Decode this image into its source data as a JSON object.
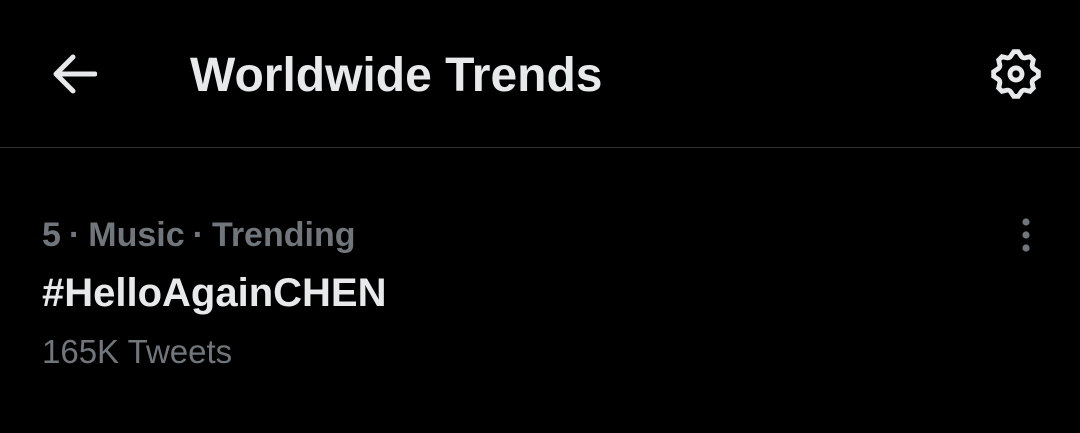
{
  "header": {
    "title": "Worldwide Trends",
    "back_icon": "arrow-left-icon",
    "settings_icon": "gear-icon"
  },
  "trends": [
    {
      "rank": "5",
      "separator": "·",
      "category": "Music",
      "status": "Trending",
      "name": "#HelloAgainCHEN",
      "count": "165K Tweets",
      "more_icon": "more-vertical-icon"
    }
  ],
  "colors": {
    "background": "#000000",
    "primary_text": "#e7e9ea",
    "secondary_text": "#71767b",
    "divider": "#2f3336"
  }
}
